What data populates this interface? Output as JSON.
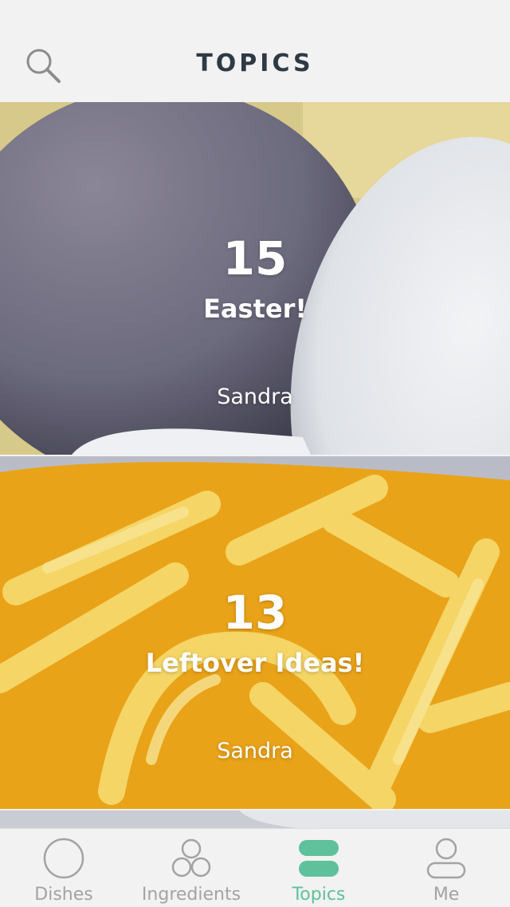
{
  "header": {
    "title": "TOPICS"
  },
  "topics": [
    {
      "count": "15",
      "name": "Easter!",
      "author": "Sandra"
    },
    {
      "count": "13",
      "name": "Leftover Ideas!",
      "author": "Sandra"
    }
  ],
  "tabs": [
    {
      "label": "Dishes",
      "icon": "circle-icon"
    },
    {
      "label": "Ingredients",
      "icon": "three-circles-icon"
    },
    {
      "label": "Topics",
      "icon": "stacked-pills-icon",
      "active": true
    },
    {
      "label": "Me",
      "icon": "person-icon"
    }
  ],
  "colors": {
    "accent": "#5fc19b",
    "inactive": "#a3a3a3",
    "title": "#2f3a44"
  }
}
